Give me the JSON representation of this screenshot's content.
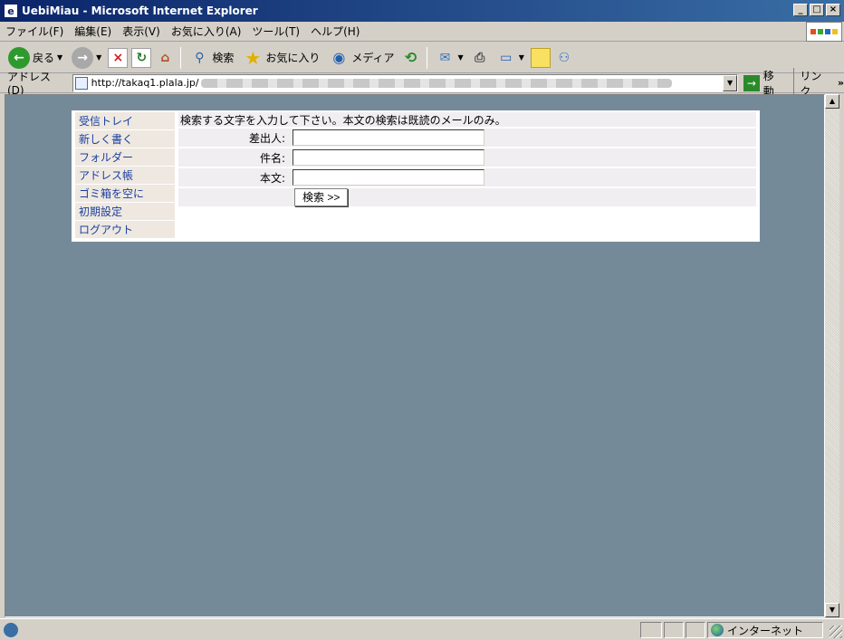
{
  "window": {
    "title": "UebiMiau - Microsoft Internet Explorer"
  },
  "menubar": {
    "items": [
      "ファイル(F)",
      "編集(E)",
      "表示(V)",
      "お気に入り(A)",
      "ツール(T)",
      "ヘルプ(H)"
    ]
  },
  "toolbar": {
    "back": "戻る",
    "search": "検索",
    "favorites": "お気に入り",
    "media": "メディア"
  },
  "address": {
    "label": "アドレス(D)",
    "url": "http://takaq1.plala.jp/",
    "go": "移動",
    "links": "リンク"
  },
  "sidebar": {
    "items": [
      "受信トレイ",
      "新しく書く",
      "フォルダー",
      "アドレス帳",
      "ゴミ箱を空に",
      "初期設定",
      "ログアウト"
    ]
  },
  "search_form": {
    "message": "検索する文字を入力して下さい。本文の検索は既読のメールのみ。",
    "from_label": "差出人:",
    "subject_label": "件名:",
    "body_label": "本文:",
    "from_value": "",
    "subject_value": "",
    "body_value": "",
    "submit": "検索 >>"
  },
  "status": {
    "zone": "インターネット"
  },
  "colors": {
    "title_start": "#0a246a",
    "title_end": "#3a6ea5",
    "page_bg": "#758a99",
    "link": "#1a3ea0",
    "sidebar_bg": "#eee8e0"
  }
}
